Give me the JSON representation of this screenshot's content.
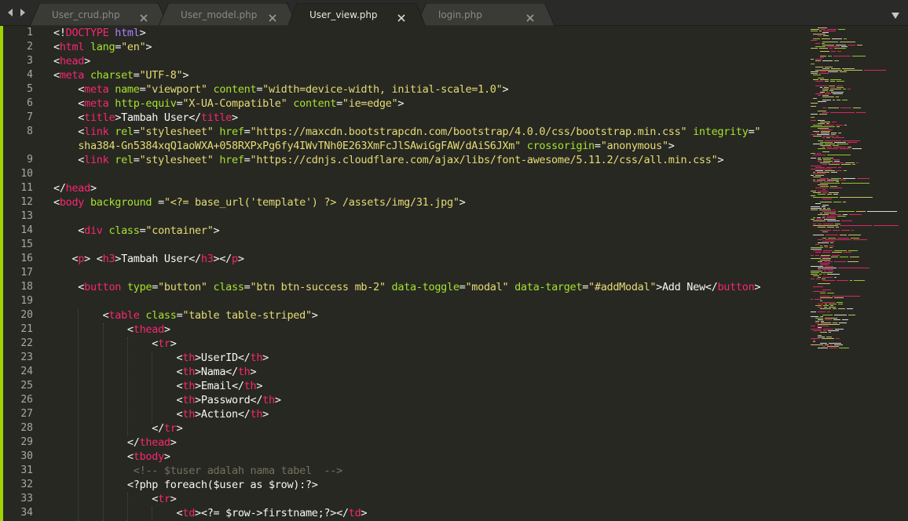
{
  "tabs": [
    {
      "label": "User_crud.php",
      "active": false
    },
    {
      "label": "User_model.php",
      "active": false
    },
    {
      "label": "User_view.php",
      "active": true
    },
    {
      "label": "login.php",
      "active": false
    }
  ],
  "colors": {
    "bg": "#272822",
    "tag": "#f92672",
    "attr": "#a6e22e",
    "string": "#e6db74",
    "text": "#f8f8f2",
    "doctype": "#ae81ff",
    "comment": "#75715e",
    "accent": "#9fd400"
  },
  "editor": {
    "lines": [
      {
        "n": "1",
        "tokens": [
          [
            "<!",
            "x"
          ],
          [
            "DOCTYPE",
            "t"
          ],
          [
            " ",
            "x"
          ],
          [
            "html",
            "p"
          ],
          [
            ">",
            "x"
          ]
        ]
      },
      {
        "n": "2",
        "tokens": [
          [
            "<",
            "x"
          ],
          [
            "html",
            "t"
          ],
          [
            " ",
            "x"
          ],
          [
            "lang",
            "a"
          ],
          [
            "=",
            "x"
          ],
          [
            "\"en\"",
            "s"
          ],
          [
            ">",
            "x"
          ]
        ]
      },
      {
        "n": "3",
        "tokens": [
          [
            "<",
            "x"
          ],
          [
            "head",
            "t"
          ],
          [
            ">",
            "x"
          ]
        ]
      },
      {
        "n": "4",
        "tokens": [
          [
            "<",
            "x"
          ],
          [
            "meta",
            "t"
          ],
          [
            " ",
            "x"
          ],
          [
            "charset",
            "a"
          ],
          [
            "=",
            "x"
          ],
          [
            "\"UTF-8\"",
            "s"
          ],
          [
            ">",
            "x"
          ]
        ]
      },
      {
        "n": "5",
        "tokens": [
          [
            "    <",
            "x"
          ],
          [
            "meta",
            "t"
          ],
          [
            " ",
            "x"
          ],
          [
            "name",
            "a"
          ],
          [
            "=",
            "x"
          ],
          [
            "\"viewport\"",
            "s"
          ],
          [
            " ",
            "x"
          ],
          [
            "content",
            "a"
          ],
          [
            "=",
            "x"
          ],
          [
            "\"width=device-width, initial-scale=1.0\"",
            "s"
          ],
          [
            ">",
            "x"
          ]
        ]
      },
      {
        "n": "6",
        "tokens": [
          [
            "    <",
            "x"
          ],
          [
            "meta",
            "t"
          ],
          [
            " ",
            "x"
          ],
          [
            "http-equiv",
            "a"
          ],
          [
            "=",
            "x"
          ],
          [
            "\"X-UA-Compatible\"",
            "s"
          ],
          [
            " ",
            "x"
          ],
          [
            "content",
            "a"
          ],
          [
            "=",
            "x"
          ],
          [
            "\"ie=edge\"",
            "s"
          ],
          [
            ">",
            "x"
          ]
        ]
      },
      {
        "n": "7",
        "tokens": [
          [
            "    <",
            "x"
          ],
          [
            "title",
            "t"
          ],
          [
            ">Tambah User</",
            "x"
          ],
          [
            "title",
            "t"
          ],
          [
            ">",
            "x"
          ]
        ]
      },
      {
        "n": "8",
        "tokens": [
          [
            "    <",
            "x"
          ],
          [
            "link",
            "t"
          ],
          [
            " ",
            "x"
          ],
          [
            "rel",
            "a"
          ],
          [
            "=",
            "x"
          ],
          [
            "\"stylesheet\"",
            "s"
          ],
          [
            " ",
            "x"
          ],
          [
            "href",
            "a"
          ],
          [
            "=",
            "x"
          ],
          [
            "\"https://maxcdn.bootstrapcdn.com/bootstrap/4.0.0/css/bootstrap.min.css\"",
            "s"
          ],
          [
            " ",
            "x"
          ],
          [
            "integrity",
            "a"
          ],
          [
            "=",
            "x"
          ],
          [
            "\"",
            "s"
          ]
        ]
      },
      {
        "n": "",
        "tokens": [
          [
            "    ",
            "x"
          ],
          [
            "sha384-Gn5384xqQ1aoWXA+058RXPxPg6fy4IWvTNh0E263XmFcJlSAwiGgFAW/dAiS6JXm\"",
            "s"
          ],
          [
            " ",
            "x"
          ],
          [
            "crossorigin",
            "a"
          ],
          [
            "=",
            "x"
          ],
          [
            "\"anonymous\"",
            "s"
          ],
          [
            ">",
            "x"
          ]
        ]
      },
      {
        "n": "9",
        "tokens": [
          [
            "    <",
            "x"
          ],
          [
            "link",
            "t"
          ],
          [
            " ",
            "x"
          ],
          [
            "rel",
            "a"
          ],
          [
            "=",
            "x"
          ],
          [
            "\"stylesheet\"",
            "s"
          ],
          [
            " ",
            "x"
          ],
          [
            "href",
            "a"
          ],
          [
            "=",
            "x"
          ],
          [
            "\"https://cdnjs.cloudflare.com/ajax/libs/font-awesome/5.11.2/css/all.min.css\"",
            "s"
          ],
          [
            ">",
            "x"
          ]
        ]
      },
      {
        "n": "10",
        "tokens": []
      },
      {
        "n": "11",
        "tokens": [
          [
            "</",
            "x"
          ],
          [
            "head",
            "t"
          ],
          [
            ">",
            "x"
          ]
        ]
      },
      {
        "n": "12",
        "tokens": [
          [
            "<",
            "x"
          ],
          [
            "body",
            "t"
          ],
          [
            " ",
            "x"
          ],
          [
            "background",
            "a"
          ],
          [
            " =",
            "x"
          ],
          [
            "\"<?= base_url('template') ?> /assets/img/31.jpg\"",
            "s"
          ],
          [
            ">",
            "x"
          ]
        ]
      },
      {
        "n": "13",
        "tokens": []
      },
      {
        "n": "14",
        "tokens": [
          [
            "    <",
            "x"
          ],
          [
            "div",
            "t"
          ],
          [
            " ",
            "x"
          ],
          [
            "class",
            "a"
          ],
          [
            "=",
            "x"
          ],
          [
            "\"container\"",
            "s"
          ],
          [
            ">",
            "x"
          ]
        ]
      },
      {
        "n": "15",
        "tokens": []
      },
      {
        "n": "16",
        "tokens": [
          [
            "   <",
            "x"
          ],
          [
            "p",
            "t"
          ],
          [
            "> <",
            "x"
          ],
          [
            "h3",
            "t"
          ],
          [
            ">Tambah User</",
            "x"
          ],
          [
            "h3",
            "t"
          ],
          [
            "></",
            "x"
          ],
          [
            "p",
            "t"
          ],
          [
            ">",
            "x"
          ]
        ]
      },
      {
        "n": "17",
        "tokens": []
      },
      {
        "n": "18",
        "tokens": [
          [
            "    <",
            "x"
          ],
          [
            "button",
            "t"
          ],
          [
            " ",
            "x"
          ],
          [
            "type",
            "a"
          ],
          [
            "=",
            "x"
          ],
          [
            "\"button\"",
            "s"
          ],
          [
            " ",
            "x"
          ],
          [
            "class",
            "a"
          ],
          [
            "=",
            "x"
          ],
          [
            "\"btn btn-success mb-2\"",
            "s"
          ],
          [
            " ",
            "x"
          ],
          [
            "data-toggle",
            "a"
          ],
          [
            "=",
            "x"
          ],
          [
            "\"modal\"",
            "s"
          ],
          [
            " ",
            "x"
          ],
          [
            "data-target",
            "a"
          ],
          [
            "=",
            "x"
          ],
          [
            "\"#addModal\"",
            "s"
          ],
          [
            ">Add New</",
            "x"
          ],
          [
            "button",
            "t"
          ],
          [
            ">",
            "x"
          ]
        ]
      },
      {
        "n": "19",
        "tokens": []
      },
      {
        "n": "20",
        "tokens": [
          [
            "        <",
            "x"
          ],
          [
            "table",
            "t"
          ],
          [
            " ",
            "x"
          ],
          [
            "class",
            "a"
          ],
          [
            "=",
            "x"
          ],
          [
            "\"table table-striped\"",
            "s"
          ],
          [
            ">",
            "x"
          ]
        ]
      },
      {
        "n": "21",
        "tokens": [
          [
            "            <",
            "x"
          ],
          [
            "thead",
            "t"
          ],
          [
            ">",
            "x"
          ]
        ]
      },
      {
        "n": "22",
        "tokens": [
          [
            "                <",
            "x"
          ],
          [
            "tr",
            "t"
          ],
          [
            ">",
            "x"
          ]
        ]
      },
      {
        "n": "23",
        "tokens": [
          [
            "                    <",
            "x"
          ],
          [
            "th",
            "t"
          ],
          [
            ">UserID</",
            "x"
          ],
          [
            "th",
            "t"
          ],
          [
            ">",
            "x"
          ]
        ]
      },
      {
        "n": "24",
        "tokens": [
          [
            "                    <",
            "x"
          ],
          [
            "th",
            "t"
          ],
          [
            ">Nama</",
            "x"
          ],
          [
            "th",
            "t"
          ],
          [
            ">",
            "x"
          ]
        ]
      },
      {
        "n": "25",
        "tokens": [
          [
            "                    <",
            "x"
          ],
          [
            "th",
            "t"
          ],
          [
            ">Email</",
            "x"
          ],
          [
            "th",
            "t"
          ],
          [
            ">",
            "x"
          ]
        ]
      },
      {
        "n": "26",
        "tokens": [
          [
            "                    <",
            "x"
          ],
          [
            "th",
            "t"
          ],
          [
            ">Password</",
            "x"
          ],
          [
            "th",
            "t"
          ],
          [
            ">",
            "x"
          ]
        ]
      },
      {
        "n": "27",
        "tokens": [
          [
            "                    <",
            "x"
          ],
          [
            "th",
            "t"
          ],
          [
            ">Action</",
            "x"
          ],
          [
            "th",
            "t"
          ],
          [
            ">",
            "x"
          ]
        ]
      },
      {
        "n": "28",
        "tokens": [
          [
            "                </",
            "x"
          ],
          [
            "tr",
            "t"
          ],
          [
            ">",
            "x"
          ]
        ]
      },
      {
        "n": "29",
        "tokens": [
          [
            "            </",
            "x"
          ],
          [
            "thead",
            "t"
          ],
          [
            ">",
            "x"
          ]
        ]
      },
      {
        "n": "30",
        "tokens": [
          [
            "            <",
            "x"
          ],
          [
            "tbody",
            "t"
          ],
          [
            ">",
            "x"
          ]
        ]
      },
      {
        "n": "31",
        "tokens": [
          [
            "             ",
            "x"
          ],
          [
            "<!-- $tuser adalah nama tabel  -->",
            "c"
          ]
        ]
      },
      {
        "n": "32",
        "tokens": [
          [
            "            <?php foreach($user as $row):?>",
            "x"
          ]
        ]
      },
      {
        "n": "33",
        "tokens": [
          [
            "                <",
            "x"
          ],
          [
            "tr",
            "t"
          ],
          [
            ">",
            "x"
          ]
        ]
      },
      {
        "n": "34",
        "tokens": [
          [
            "                    <",
            "x"
          ],
          [
            "td",
            "t"
          ],
          [
            "><?= $row->firstname;?></",
            "x"
          ],
          [
            "td",
            "t"
          ],
          [
            ">",
            "x"
          ]
        ]
      }
    ]
  }
}
